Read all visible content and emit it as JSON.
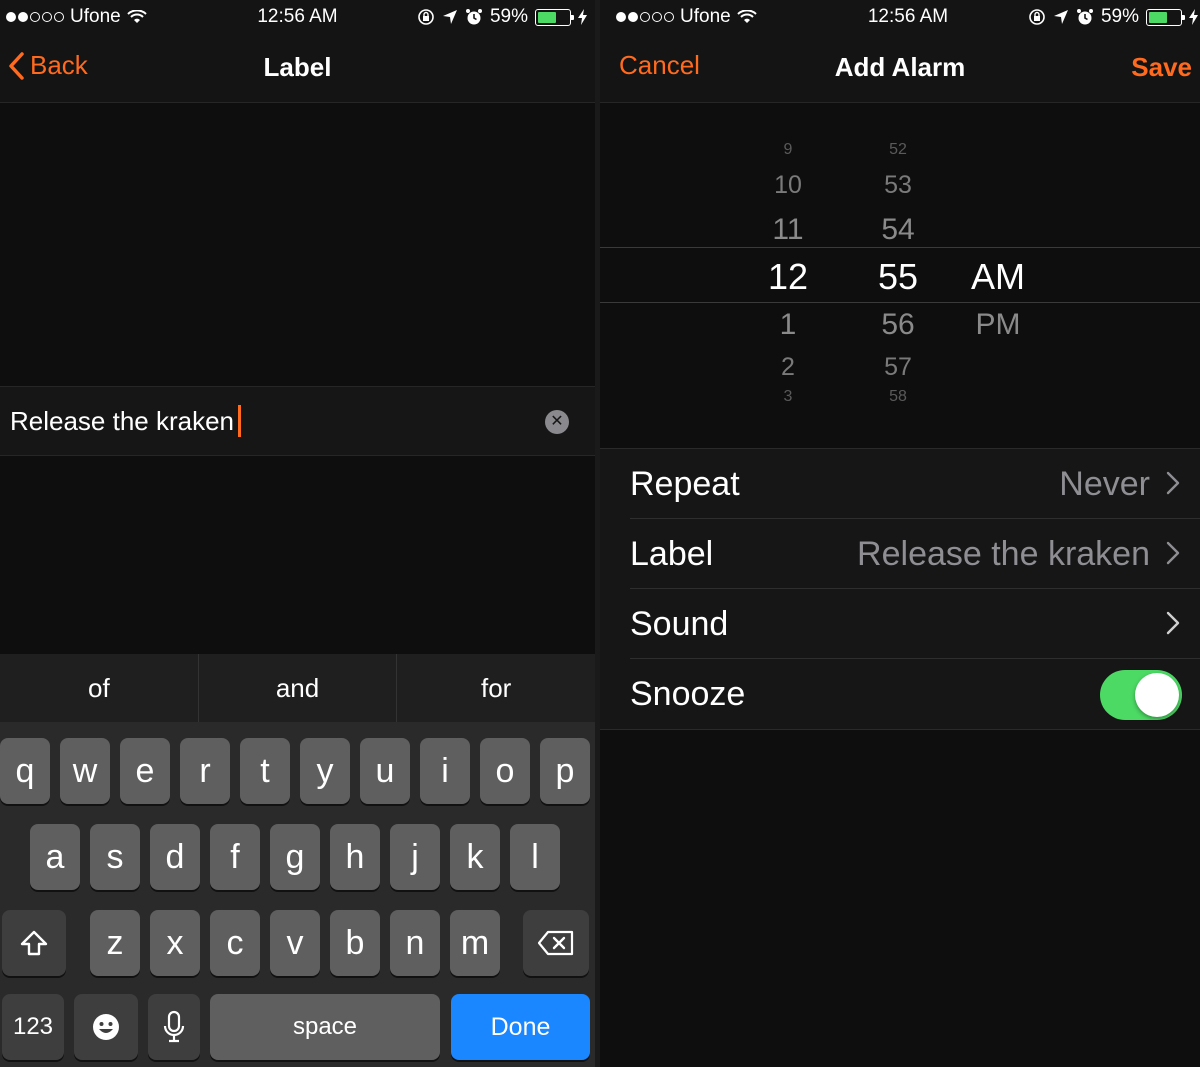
{
  "status": {
    "carrier": "Ufone",
    "time": "12:56 AM",
    "battery": "59%",
    "battery_level": 0.59
  },
  "left": {
    "back_label": "Back",
    "title": "Label",
    "field_value": "Release the kraken",
    "suggestions": [
      "of",
      "and",
      "for"
    ],
    "keyboard": {
      "row1": [
        "q",
        "w",
        "e",
        "r",
        "t",
        "y",
        "u",
        "i",
        "o",
        "p"
      ],
      "row2": [
        "a",
        "s",
        "d",
        "f",
        "g",
        "h",
        "j",
        "k",
        "l"
      ],
      "row3": [
        "z",
        "x",
        "c",
        "v",
        "b",
        "n",
        "m"
      ],
      "numbers_label": "123",
      "space_label": "space",
      "done_label": "Done"
    }
  },
  "right": {
    "cancel_label": "Cancel",
    "title": "Add Alarm",
    "save_label": "Save",
    "picker": {
      "hours": [
        "9",
        "10",
        "11",
        "12",
        "1",
        "2",
        "3"
      ],
      "minutes": [
        "52",
        "53",
        "54",
        "55",
        "56",
        "57",
        "58"
      ],
      "selected_hour": "12",
      "selected_minute": "55",
      "ampm": [
        "AM",
        "PM"
      ],
      "selected_ampm": "AM"
    },
    "settings": {
      "repeat_label": "Repeat",
      "repeat_value": "Never",
      "label_label": "Label",
      "label_value": "Release the kraken",
      "sound_label": "Sound",
      "snooze_label": "Snooze",
      "snooze_on": true
    }
  },
  "colors": {
    "accent": "#ff6a1f",
    "toggle_on": "#4cd964",
    "done_key": "#1a86ff"
  }
}
